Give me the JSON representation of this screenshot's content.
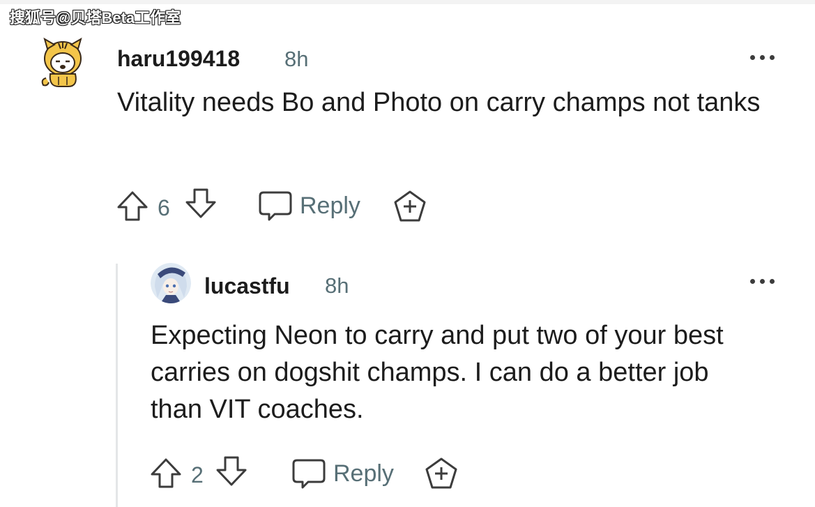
{
  "watermark": {
    "text": "搜狐号@贝塔Beta工作室"
  },
  "comments": [
    {
      "username": "haru199418",
      "time": "8h",
      "body": "Vitality needs Bo and Photo on carry champs not tanks",
      "votes": "6",
      "reply_label": "Reply",
      "avatar_icon": "tiger-costume-avatar-icon"
    },
    {
      "username": "lucastfu",
      "time": "8h",
      "body": "Expecting Neon to carry and put two of your best carries on dogshit champs. I can do a better job than VIT coaches.",
      "votes": "2",
      "reply_label": "Reply",
      "avatar_icon": "anime-character-avatar-icon"
    }
  ],
  "icons": {
    "upvote": "upvote-arrow-icon",
    "downvote": "downvote-arrow-icon",
    "reply": "speech-bubble-icon",
    "award": "award-plus-icon",
    "more": "more-options-icon"
  },
  "colors": {
    "text": "#1c1c1c",
    "meta": "#576f76",
    "icon_stroke": "#3c3c3c",
    "thread_line": "#e4e6e8"
  }
}
